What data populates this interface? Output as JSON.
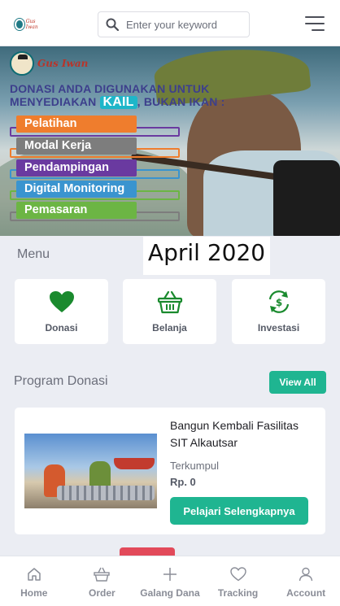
{
  "header": {
    "logo_text": "Gus Iwan",
    "search_placeholder": "Enter your keyword"
  },
  "banner": {
    "logo_text": "Gus Iwan",
    "headline_line1": "DONASI ANDA DIGUNAKAN UNTUK",
    "headline_line2_pre": "MENYEDIAKAN",
    "headline_kail": "KAIL",
    "headline_line2_post": ", BUKAN IKAN :",
    "items": [
      {
        "label": "Pelatihan",
        "color": "#ef7d2d"
      },
      {
        "label": "Modal Kerja",
        "color": "#7d7d7d"
      },
      {
        "label": "Pendampingan",
        "color": "#6a3aa0"
      },
      {
        "label": "Digital Monitoring",
        "color": "#3a94cf"
      },
      {
        "label": "Pemasaran",
        "color": "#6cb544"
      }
    ]
  },
  "menu": {
    "title": "Menu",
    "date_stamp": "April 2020",
    "items": [
      {
        "label": "Donasi",
        "icon": "heart-icon"
      },
      {
        "label": "Belanja",
        "icon": "basket-icon"
      },
      {
        "label": "Investasi",
        "icon": "investment-icon"
      }
    ]
  },
  "program": {
    "title": "Program Donasi",
    "view_all_label": "View All",
    "card": {
      "name": "Bangun Kembali Fasilitas SIT Alkautsar",
      "collected_label": "Terkumpul",
      "collected_amount": "Rp. 0",
      "learn_more_label": "Pelajari Selengkapnya"
    }
  },
  "bottom_nav": {
    "items": [
      {
        "label": "Home",
        "icon": "home-icon"
      },
      {
        "label": "Order",
        "icon": "basket-icon"
      },
      {
        "label": "Galang Dana",
        "icon": "plus-icon"
      },
      {
        "label": "Tracking",
        "icon": "heart-icon"
      },
      {
        "label": "Account",
        "icon": "user-icon"
      }
    ]
  },
  "colors": {
    "accent_green": "#1fb591",
    "icon_green": "#1a8a2e",
    "background": "#ebedf3"
  }
}
